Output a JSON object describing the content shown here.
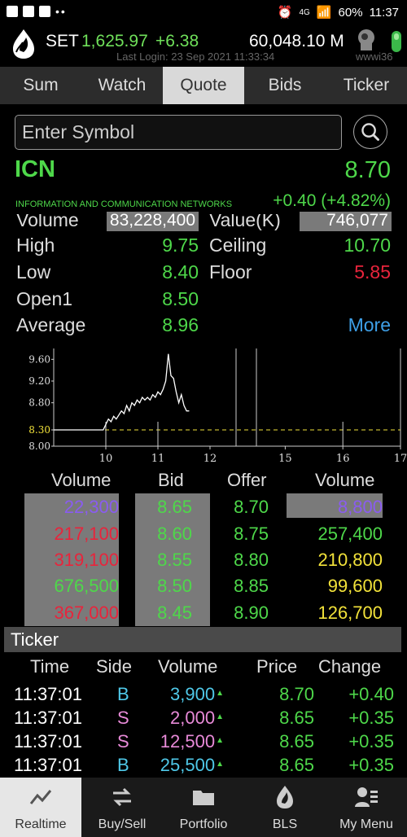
{
  "status_bar": {
    "battery": "60%",
    "time": "11:37",
    "network": "4G"
  },
  "header": {
    "index_name": "SET",
    "index_value": "1,625.97",
    "index_change": "+6.38",
    "volume": "60,048.10 M",
    "last_login": "Last Login: 23 Sep 2021 11:33:34",
    "user_id": "wwwi36"
  },
  "tabs": [
    {
      "label": "Sum"
    },
    {
      "label": "Watch"
    },
    {
      "label": "Quote",
      "active": true
    },
    {
      "label": "Bids"
    },
    {
      "label": "Ticker"
    }
  ],
  "search": {
    "placeholder": "Enter Symbol"
  },
  "symbol": {
    "code": "ICN",
    "price": "8.70",
    "name": "INFORMATION AND COMMUNICATION NETWORKS",
    "change": "+0.40 (+4.82%)"
  },
  "stats": {
    "volume_label": "Volume",
    "volume_value": "83,228,400",
    "value_label": "Value(K)",
    "value_value": "746,077",
    "high_label": "High",
    "high_value": "9.75",
    "ceiling_label": "Ceiling",
    "ceiling_value": "10.70",
    "low_label": "Low",
    "low_value": "8.40",
    "floor_label": "Floor",
    "floor_value": "5.85",
    "open_label": "Open1",
    "open_value": "8.50",
    "average_label": "Average",
    "average_value": "8.96",
    "more_label": "More"
  },
  "colors": {
    "green": "#4ed84a",
    "red": "#e8243c",
    "yellow": "#f2e23a",
    "purple": "#8a5cf0",
    "blue": "#3ea0e8",
    "pink": "#e88ad8",
    "cyan": "#4fc8e8"
  },
  "chart_data": {
    "type": "line",
    "y_ticks": [
      "9.60",
      "9.20",
      "8.80",
      "8.30",
      "8.00"
    ],
    "x_ticks": [
      "10",
      "11",
      "12",
      "15",
      "16",
      "17"
    ],
    "ylim": [
      8.0,
      9.8
    ],
    "prior_close": 8.3,
    "series": [
      {
        "x": [
          9.0,
          9.95,
          10.0,
          10.05,
          10.1,
          10.15,
          10.2,
          10.3,
          10.35,
          10.4,
          10.45,
          10.5,
          10.55,
          10.6,
          10.65,
          10.7,
          10.75,
          10.8,
          10.85,
          10.9,
          10.95,
          11.0,
          11.05,
          11.1,
          11.15,
          11.2,
          11.25,
          11.3,
          11.35,
          11.4,
          11.45,
          11.5,
          11.55,
          11.6
        ],
        "y": [
          8.3,
          8.3,
          8.4,
          8.5,
          8.45,
          8.55,
          8.5,
          8.65,
          8.6,
          8.75,
          8.65,
          8.8,
          8.75,
          8.85,
          8.8,
          8.9,
          8.85,
          8.9,
          8.85,
          8.95,
          8.9,
          9.0,
          8.95,
          9.05,
          9.2,
          9.7,
          9.3,
          9.25,
          9.0,
          8.8,
          8.95,
          8.75,
          8.65,
          8.65
        ]
      }
    ]
  },
  "bid_offer": {
    "headers": {
      "bid_volume": "Volume",
      "bid": "Bid",
      "offer": "Offer",
      "offer_volume": "Volume"
    },
    "rows": [
      {
        "bid_vol": "22,300",
        "bid": "8.65",
        "offer": "8.70",
        "offer_vol": "8,800"
      },
      {
        "bid_vol": "217,100",
        "bid": "8.60",
        "offer": "8.75",
        "offer_vol": "257,400"
      },
      {
        "bid_vol": "319,100",
        "bid": "8.55",
        "offer": "8.80",
        "offer_vol": "210,800"
      },
      {
        "bid_vol": "676,500",
        "bid": "8.50",
        "offer": "8.85",
        "offer_vol": "99,600"
      },
      {
        "bid_vol": "367,000",
        "bid": "8.45",
        "offer": "8.90",
        "offer_vol": "126,700"
      }
    ]
  },
  "ticker": {
    "title": "Ticker",
    "headers": {
      "time": "Time",
      "side": "Side",
      "volume": "Volume",
      "price": "Price",
      "change": "Change"
    },
    "rows": [
      {
        "time": "11:37:01",
        "side": "B",
        "volume": "3,900",
        "price": "8.70",
        "change": "+0.40"
      },
      {
        "time": "11:37:01",
        "side": "S",
        "volume": "2,000",
        "price": "8.65",
        "change": "+0.35"
      },
      {
        "time": "11:37:01",
        "side": "S",
        "volume": "12,500",
        "price": "8.65",
        "change": "+0.35"
      },
      {
        "time": "11:37:01",
        "side": "B",
        "volume": "25,500",
        "price": "8.65",
        "change": "+0.35"
      }
    ]
  },
  "bottom_nav": [
    {
      "label": "Realtime",
      "icon": "pulse-chart-icon",
      "active": true
    },
    {
      "label": "Buy/Sell",
      "icon": "swap-arrows-icon"
    },
    {
      "label": "Portfolio",
      "icon": "folder-icon"
    },
    {
      "label": "BLS",
      "icon": "bls-logo-icon"
    },
    {
      "label": "My Menu",
      "icon": "user-menu-icon"
    }
  ]
}
